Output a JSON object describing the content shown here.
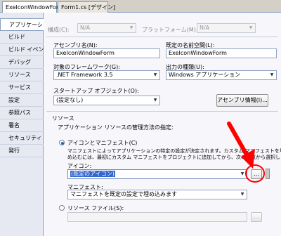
{
  "tabs": [
    {
      "label": "ExeIconWindowForm"
    },
    {
      "label": "Form1.cs [デザイン]"
    }
  ],
  "sidebar": {
    "items": [
      {
        "label": "アプリケーション"
      },
      {
        "label": "ビルド"
      },
      {
        "label": "ビルド イベント"
      },
      {
        "label": "デバッグ"
      },
      {
        "label": "リソース"
      },
      {
        "label": "サービス"
      },
      {
        "label": "設定"
      },
      {
        "label": "参照パス"
      },
      {
        "label": "署名"
      },
      {
        "label": "セキュリティ"
      },
      {
        "label": "発行"
      }
    ]
  },
  "toolbar": {
    "config_label": "構成(C):",
    "config_value": "N/A",
    "platform_label": "プラットフォーム(M):",
    "platform_value": "N/A"
  },
  "form": {
    "assembly_label": "アセンブリ名(N):",
    "assembly_value": "ExeIconWindowForm",
    "namespace_label": "既定の名前空間(L):",
    "namespace_value": "ExeIconWindowForm",
    "framework_label": "対象のフレームワーク(G):",
    "framework_value": ".NET Framework 3.5",
    "output_label": "出力の種類(U):",
    "output_value": "Windows アプリケーション",
    "startup_label": "スタートアップ オブジェクト(O):",
    "startup_value": "(設定なし)",
    "assembly_info_button": "アセンブリ情報(I)..."
  },
  "resources": {
    "section_title": "リソース",
    "description": "アプリケーション リソースの管理方法の指定:",
    "radio_icon_manifest": "アイコンとマニフェスト(C)",
    "manifest_desc_line1": "マニフェストによってアプリケーションの特定の設定が決定されます。カスタム マニフェストを埋",
    "manifest_desc_line2": "め込むには、最初にカスタム マニフェストをプロジェクトに追加してから、次の一覧から選択します",
    "icon_label": "アイコン:",
    "icon_value": "(既定のアイコン)",
    "browse_button": "...",
    "manifest_label": "マニフェスト:",
    "manifest_value": "マニフェストを既定の設定で埋め込みます",
    "radio_resource_file": "リソース ファイル(S):",
    "resource_browse_button": "..."
  },
  "annotation": {
    "arrow_color": "#ff0000",
    "circle_color": "#ff0000"
  }
}
